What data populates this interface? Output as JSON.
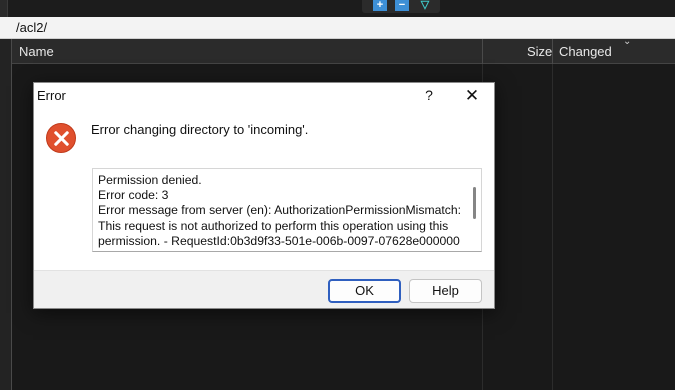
{
  "toolbar": {
    "icons": [
      "plus-icon",
      "minus-icon",
      "filter-icon"
    ],
    "glyphs": {
      "plus": "+",
      "minus": "−",
      "filter": "▽"
    }
  },
  "path_bar": {
    "path": "/acl2/"
  },
  "columns": {
    "name": "Name",
    "size": "Size",
    "changed": "Changed",
    "sort_icon": "chevron-down-icon",
    "sort_glyph": "⌄"
  },
  "dialog": {
    "title": "Error",
    "help_glyph": "?",
    "close_glyph": "✕",
    "headline": "Error changing directory to 'incoming'.",
    "details": "Permission denied.\nError code: 3\nError message from server (en): AuthorizationPermissionMismatch:\nThis request is not authorized to perform this operation using this permission. - RequestId:0b3d9f33-501e-006b-0097-07628e000000",
    "ok_label": "OK",
    "help_label": "Help"
  },
  "colors": {
    "accent": "#2f5fbf",
    "error": "#e0502e",
    "panel_dark": "#1e1e1e"
  }
}
